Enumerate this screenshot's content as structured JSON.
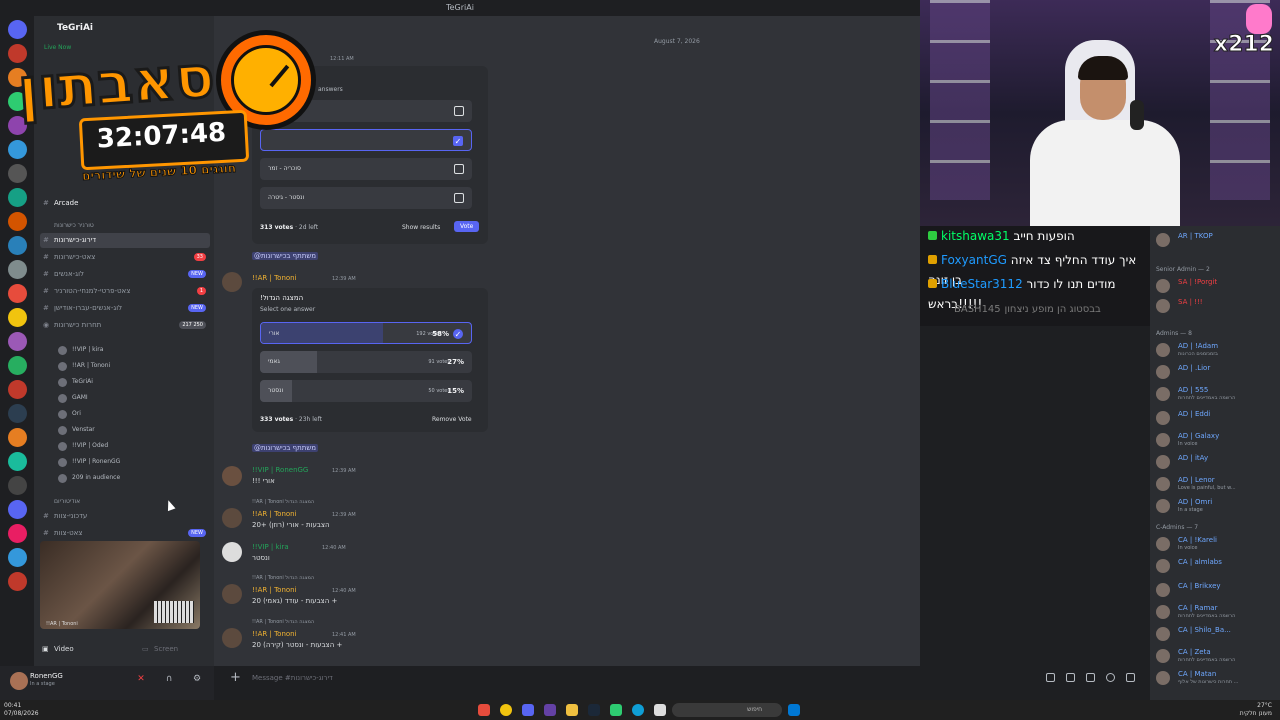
{
  "window_title": "TeGriAi",
  "server": {
    "name": "TeGriAi",
    "live_now": "Live Now",
    "category_voice": "טורניר כישרונות",
    "category_audio": "אודיטוריום",
    "arcade": "Arcade",
    "channels": [
      {
        "name": "דירוג-כישרונות",
        "active": true,
        "badge": ""
      },
      {
        "name": "צאט-כישרונות",
        "badge": "33"
      },
      {
        "name": "לוג-אנשים",
        "badge": "NEW"
      },
      {
        "name": "צאט-פרטי-למנחי-הטורניר",
        "badge": "1"
      },
      {
        "name": "לוג-אנשים-עברו-אודישן",
        "badge": "NEW"
      },
      {
        "name": "תחרות כישרונות",
        "badge": "217 250"
      }
    ],
    "voice_users": [
      "!!VIP | kira",
      "!!AR | Tononi",
      "TeGriAi",
      "GAMI",
      "Ori",
      "Venstar",
      "!!VIP | Oded",
      "!!VIP | RonenGG",
      "209 in audience"
    ],
    "channels_bottom": [
      {
        "name": "עדכוני-צוות",
        "badge": ""
      },
      {
        "name": "צאט-צוות",
        "badge": "NEW"
      }
    ],
    "stream_caption": "!!AR | Tononi",
    "video_label": "Video",
    "screen_label": "Screen"
  },
  "user": {
    "name": "RonenGG",
    "status": "In a stage"
  },
  "overlay": {
    "title": "סאבתון",
    "timer": "32:07:48",
    "subtitle": "חוגגים 10 שנים של שידורים"
  },
  "chat": {
    "header": "דירוג-כ",
    "date": "August 7, 2026",
    "poll1": {
      "time": "12:11 AM",
      "hint": "answers",
      "options": [
        {
          "label": "",
          "checked": false
        },
        {
          "label": "",
          "checked": true
        },
        {
          "label": "סוכריה - זמר",
          "checked": false
        },
        {
          "label": "ונסטר - גיטרה",
          "checked": false
        }
      ],
      "votes": "313 votes",
      "time_left": "2d left",
      "show_results": "Show results",
      "vote": "Vote"
    },
    "mention1": "@משתתף בכישרונות",
    "poll2": {
      "author": "!!AR | Tononi",
      "time": "12:39 AM",
      "question": "!המצגה הגדול",
      "hint": "Select one answer",
      "options": [
        {
          "label": "אורי",
          "votes": "192 votes",
          "pct": "58%",
          "fill": 0.58,
          "winner": true
        },
        {
          "label": "גאמי",
          "votes": "91 votes",
          "pct": "27%",
          "fill": 0.27,
          "winner": false
        },
        {
          "label": "ונסטר",
          "votes": "50 votes",
          "pct": "15%",
          "fill": 0.15,
          "winner": false
        }
      ],
      "votes": "333 votes",
      "time_left": "23h left",
      "remove_vote": "Remove Vote"
    },
    "mention2": "@משתתף בכישרונות",
    "messages": [
      {
        "author": "!!VIP | RonenGG",
        "time": "12:39 AM",
        "reply": "",
        "text": "!!! אורי"
      },
      {
        "author": "!!AR | Tononi",
        "time": "12:39 AM",
        "reply": "!!AR | Tononi  המצגה הגדול",
        "text": "20+ הצבעות - אורי (רוזן)"
      },
      {
        "author": "!!VIP | kira",
        "time": "12:40 AM",
        "reply": "",
        "text": "ונסטר"
      },
      {
        "author": "!!AR | Tononi",
        "time": "12:40 AM",
        "reply": "!!AR | Tononi  המצגה הגדול",
        "text": "20 הצבעות - עודד (גאמי) +"
      },
      {
        "author": "!!AR | Tononi",
        "time": "12:41 AM",
        "reply": "!!AR | Tononi  המצגה הגדול",
        "text": "20 הצבעות - ונסטר (קירה) +"
      }
    ],
    "composer_placeholder": "Message #דירוג-כישרונות"
  },
  "webcam": {
    "counter": "x212"
  },
  "stream_chat": [
    {
      "user": "kitshawa31",
      "text": "הופעות חייב",
      "badge": "green"
    },
    {
      "user": "FoxyantGG",
      "text": "איך עודד החליף צד איזה בן זונה"
    },
    {
      "user": "BlueStar3112",
      "text": "מודים תנו לו כדור בראש!!!!!"
    },
    {
      "user": "BASH145",
      "text": "בבסטוג הן מופע ניצחון",
      "faded": true
    }
  ],
  "members": {
    "top": [
      {
        "name": "AR | TKOP",
        "sub": ""
      },
      {
        "name": "SA | !Porgit",
        "sub": ""
      },
      {
        "name": "SA | !!!",
        "sub": ""
      }
    ],
    "senior_admin": "Senior Admin — 2",
    "admins_label": "Admins — 8",
    "admins": [
      {
        "name": "AD | !Adam",
        "sub": "בזמנזמנים הכרונות"
      },
      {
        "name": "AD | .Lior",
        "sub": ""
      },
      {
        "name": "AD | 555",
        "sub": "הרשמה באמדיינים לתחרות"
      },
      {
        "name": "AD | Eddi",
        "sub": ""
      },
      {
        "name": "AD | Galaxy",
        "sub": "In voice"
      },
      {
        "name": "AD | itAy",
        "sub": ""
      },
      {
        "name": "AD | Lenor",
        "sub": "Love is painful, but w..."
      },
      {
        "name": "AD | Omri",
        "sub": "In a stage"
      }
    ],
    "cadmins_label": "C-Admins — 7",
    "cadmins": [
      {
        "name": "CA | !Kareli",
        "sub": "In voice"
      },
      {
        "name": "CA | almlabs",
        "sub": ""
      },
      {
        "name": "CA | Brikxey",
        "sub": ""
      },
      {
        "name": "CA | Ramar",
        "sub": "הרשמה באמדיינים לתחרות"
      },
      {
        "name": "CA | Shilo_Ba...",
        "sub": ""
      },
      {
        "name": "CA | Zeta",
        "sub": "הרשמה באמדיינים לתחרות"
      },
      {
        "name": "CA | Matan",
        "sub": "תחרות כישרונות של אלוף ..."
      }
    ]
  },
  "taskbar": {
    "time": "00:41",
    "date": "07/08/2026",
    "search": "חיפוש",
    "weather": "27°C",
    "weather_desc": "מעונן חלקית"
  }
}
